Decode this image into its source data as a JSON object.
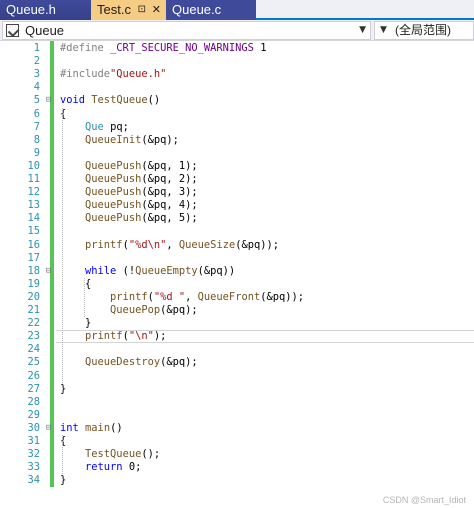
{
  "tabs": [
    {
      "label": "Queue.h"
    },
    {
      "label": "Test.c",
      "pin": "⊡",
      "close": "✕"
    },
    {
      "label": "Queue.c"
    }
  ],
  "nav": {
    "scope": "Queue",
    "function": "(全局范围)"
  },
  "colors": {
    "keyword": "#0000ff",
    "string": "#a31515",
    "preprocessor": "#808080",
    "macro": "#6f008a",
    "function": "#74531f",
    "type": "#2b91af",
    "line_number": "#2b91af",
    "change_bar": "#57c457"
  },
  "code_lines": [
    {
      "n": "1",
      "fold": "",
      "tokens": [
        {
          "t": "#define ",
          "c": "preprocessor"
        },
        {
          "t": "_CRT_SECURE_NO_WARNINGS",
          "c": "macro"
        },
        {
          "t": " 1",
          "c": "plain"
        }
      ]
    },
    {
      "n": "2",
      "fold": "",
      "tokens": []
    },
    {
      "n": "3",
      "fold": "",
      "tokens": [
        {
          "t": "#include",
          "c": "preprocessor"
        },
        {
          "t": "\"Queue.h\"",
          "c": "string"
        }
      ]
    },
    {
      "n": "4",
      "fold": "",
      "tokens": []
    },
    {
      "n": "5",
      "fold": "⊟",
      "tokens": [
        {
          "t": "void",
          "c": "keyword"
        },
        {
          "t": " ",
          "c": "plain"
        },
        {
          "t": "TestQueue",
          "c": "function"
        },
        {
          "t": "()",
          "c": "plain"
        }
      ]
    },
    {
      "n": "6",
      "fold": "",
      "tokens": [
        {
          "t": "{",
          "c": "plain"
        }
      ]
    },
    {
      "n": "7",
      "fold": "",
      "tokens": [
        {
          "t": "    ",
          "c": "plain"
        },
        {
          "t": "Que",
          "c": "type"
        },
        {
          "t": " pq;",
          "c": "plain"
        }
      ]
    },
    {
      "n": "8",
      "fold": "",
      "tokens": [
        {
          "t": "    ",
          "c": "plain"
        },
        {
          "t": "QueueInit",
          "c": "function"
        },
        {
          "t": "(&pq);",
          "c": "plain"
        }
      ]
    },
    {
      "n": "9",
      "fold": "",
      "tokens": []
    },
    {
      "n": "10",
      "fold": "",
      "tokens": [
        {
          "t": "    ",
          "c": "plain"
        },
        {
          "t": "QueuePush",
          "c": "function"
        },
        {
          "t": "(&pq, 1);",
          "c": "plain"
        }
      ]
    },
    {
      "n": "11",
      "fold": "",
      "tokens": [
        {
          "t": "    ",
          "c": "plain"
        },
        {
          "t": "QueuePush",
          "c": "function"
        },
        {
          "t": "(&pq, 2);",
          "c": "plain"
        }
      ]
    },
    {
      "n": "12",
      "fold": "",
      "tokens": [
        {
          "t": "    ",
          "c": "plain"
        },
        {
          "t": "QueuePush",
          "c": "function"
        },
        {
          "t": "(&pq, 3);",
          "c": "plain"
        }
      ]
    },
    {
      "n": "13",
      "fold": "",
      "tokens": [
        {
          "t": "    ",
          "c": "plain"
        },
        {
          "t": "QueuePush",
          "c": "function"
        },
        {
          "t": "(&pq, 4);",
          "c": "plain"
        }
      ]
    },
    {
      "n": "14",
      "fold": "",
      "tokens": [
        {
          "t": "    ",
          "c": "plain"
        },
        {
          "t": "QueuePush",
          "c": "function"
        },
        {
          "t": "(&pq, 5);",
          "c": "plain"
        }
      ]
    },
    {
      "n": "15",
      "fold": "",
      "tokens": []
    },
    {
      "n": "16",
      "fold": "",
      "tokens": [
        {
          "t": "    ",
          "c": "plain"
        },
        {
          "t": "printf",
          "c": "function"
        },
        {
          "t": "(",
          "c": "plain"
        },
        {
          "t": "\"%d\\n\"",
          "c": "string"
        },
        {
          "t": ", ",
          "c": "plain"
        },
        {
          "t": "QueueSize",
          "c": "function"
        },
        {
          "t": "(&pq));",
          "c": "plain"
        }
      ]
    },
    {
      "n": "17",
      "fold": "",
      "tokens": []
    },
    {
      "n": "18",
      "fold": "⊟",
      "tokens": [
        {
          "t": "    ",
          "c": "plain"
        },
        {
          "t": "while",
          "c": "keyword"
        },
        {
          "t": " (!",
          "c": "plain"
        },
        {
          "t": "QueueEmpty",
          "c": "function"
        },
        {
          "t": "(&pq))",
          "c": "plain"
        }
      ]
    },
    {
      "n": "19",
      "fold": "",
      "tokens": [
        {
          "t": "    {",
          "c": "plain"
        }
      ]
    },
    {
      "n": "20",
      "fold": "",
      "tokens": [
        {
          "t": "        ",
          "c": "plain"
        },
        {
          "t": "printf",
          "c": "function"
        },
        {
          "t": "(",
          "c": "plain"
        },
        {
          "t": "\"%d \"",
          "c": "string"
        },
        {
          "t": ", ",
          "c": "plain"
        },
        {
          "t": "QueueFront",
          "c": "function"
        },
        {
          "t": "(&pq));",
          "c": "plain"
        }
      ]
    },
    {
      "n": "21",
      "fold": "",
      "tokens": [
        {
          "t": "        ",
          "c": "plain"
        },
        {
          "t": "QueuePop",
          "c": "function"
        },
        {
          "t": "(&pq);",
          "c": "plain"
        }
      ]
    },
    {
      "n": "22",
      "fold": "",
      "tokens": [
        {
          "t": "    }",
          "c": "plain"
        }
      ]
    },
    {
      "n": "23",
      "fold": "",
      "tokens": [
        {
          "t": "    ",
          "c": "plain"
        },
        {
          "t": "printf",
          "c": "function"
        },
        {
          "t": "(",
          "c": "plain"
        },
        {
          "t": "\"\\n\"",
          "c": "string"
        },
        {
          "t": ");",
          "c": "plain"
        }
      ]
    },
    {
      "n": "24",
      "fold": "",
      "tokens": []
    },
    {
      "n": "25",
      "fold": "",
      "tokens": [
        {
          "t": "    ",
          "c": "plain"
        },
        {
          "t": "QueueDestroy",
          "c": "function"
        },
        {
          "t": "(&pq);",
          "c": "plain"
        }
      ]
    },
    {
      "n": "26",
      "fold": "",
      "tokens": []
    },
    {
      "n": "27",
      "fold": "",
      "tokens": [
        {
          "t": "}",
          "c": "plain"
        }
      ]
    },
    {
      "n": "28",
      "fold": "",
      "tokens": []
    },
    {
      "n": "29",
      "fold": "",
      "tokens": []
    },
    {
      "n": "30",
      "fold": "⊟",
      "tokens": [
        {
          "t": "int",
          "c": "keyword"
        },
        {
          "t": " ",
          "c": "plain"
        },
        {
          "t": "main",
          "c": "function"
        },
        {
          "t": "()",
          "c": "plain"
        }
      ]
    },
    {
      "n": "31",
      "fold": "",
      "tokens": [
        {
          "t": "{",
          "c": "plain"
        }
      ]
    },
    {
      "n": "32",
      "fold": "",
      "tokens": [
        {
          "t": "    ",
          "c": "plain"
        },
        {
          "t": "TestQueue",
          "c": "function"
        },
        {
          "t": "();",
          "c": "plain"
        }
      ]
    },
    {
      "n": "33",
      "fold": "",
      "tokens": [
        {
          "t": "    ",
          "c": "plain"
        },
        {
          "t": "return",
          "c": "keyword"
        },
        {
          "t": " 0;",
          "c": "plain"
        }
      ]
    },
    {
      "n": "34",
      "fold": "",
      "tokens": [
        {
          "t": "}",
          "c": "plain"
        }
      ]
    }
  ],
  "watermark": "CSDN @Smart_Idiot"
}
